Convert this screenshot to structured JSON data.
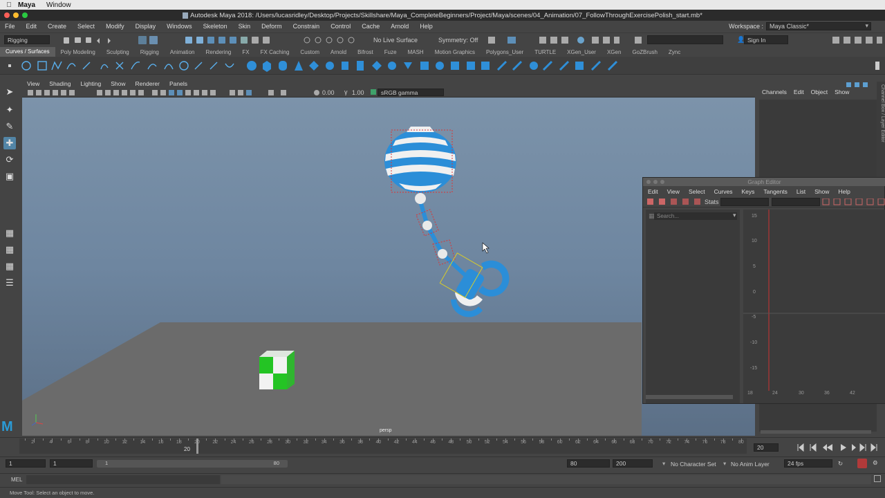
{
  "mac_menubar": {
    "app": "Maya",
    "items": [
      "Window"
    ]
  },
  "window": {
    "title": "Autodesk Maya 2018: /Users/lucasridley/Desktop/Projects/Skillshare/Maya_CompleteBeginners/Project/Maya/scenes/04_Animation/07_FollowThroughExercisePolish_start.mb*"
  },
  "main_menu": [
    "File",
    "Edit",
    "Create",
    "Select",
    "Modify",
    "Display",
    "Windows",
    "Skeleton",
    "Skin",
    "Deform",
    "Constrain",
    "Control",
    "Cache",
    "Arnold",
    "Help"
  ],
  "workspace": {
    "label": "Workspace :",
    "value": "Maya Classic*"
  },
  "status_line": {
    "mode": "Rigging",
    "live_surface": "No Live Surface",
    "symmetry": "Symmetry: Off",
    "sign_in": "Sign In"
  },
  "shelf_tabs": [
    "Curves / Surfaces",
    "Poly Modeling",
    "Sculpting",
    "Rigging",
    "Animation",
    "Rendering",
    "FX",
    "FX Caching",
    "Custom",
    "Arnold",
    "Bifrost",
    "Fuze",
    "MASH",
    "Motion Graphics",
    "Polygons_User",
    "TURTLE",
    "XGen_User",
    "XGen",
    "GoZBrush",
    "Zync"
  ],
  "shelf_active": "Curves / Surfaces",
  "panel_menu": [
    "View",
    "Shading",
    "Lighting",
    "Show",
    "Renderer",
    "Panels"
  ],
  "panel_toolbar": {
    "exposure": "0.00",
    "gamma": "1.00",
    "color_space": "sRGB gamma"
  },
  "viewport": {
    "camera_label": "persp"
  },
  "channel_box_menu": [
    "Channels",
    "Edit",
    "Object",
    "Show"
  ],
  "side_tabs": "Channel Box / Layer Editor",
  "graph_editor": {
    "title": "Graph Editor",
    "menu": [
      "Edit",
      "View",
      "Select",
      "Curves",
      "Keys",
      "Tangents",
      "List",
      "Show",
      "Help"
    ],
    "stats_label": "Stats",
    "search_placeholder": "Search...",
    "y_labels": [
      "15",
      "10",
      "5",
      "0",
      "-5",
      "-10",
      "-15"
    ],
    "x_labels": [
      "18",
      "24",
      "30",
      "36",
      "42"
    ]
  },
  "time_slider": {
    "labels": [
      "2",
      "4",
      "6",
      "8",
      "10",
      "12",
      "14",
      "16",
      "18",
      "20",
      "22",
      "24",
      "26",
      "28",
      "30",
      "32",
      "34",
      "36",
      "38",
      "40",
      "42",
      "44",
      "46",
      "48",
      "50",
      "52",
      "54",
      "56",
      "58",
      "60",
      "62",
      "64",
      "66",
      "68",
      "70",
      "72",
      "74",
      "76",
      "78",
      "80"
    ],
    "current_frame_marker": "20",
    "current_frame_field": "20"
  },
  "range_slider": {
    "start": "1",
    "start_inner": "1",
    "range_handle_start": "1",
    "range_handle_end": "80",
    "end_inner": "80",
    "end": "200",
    "character_set": "No Character Set",
    "anim_layer": "No Anim Layer",
    "fps": "24 fps"
  },
  "command_line": {
    "label": "MEL"
  },
  "help_line": "Move Tool: Select an object to move."
}
